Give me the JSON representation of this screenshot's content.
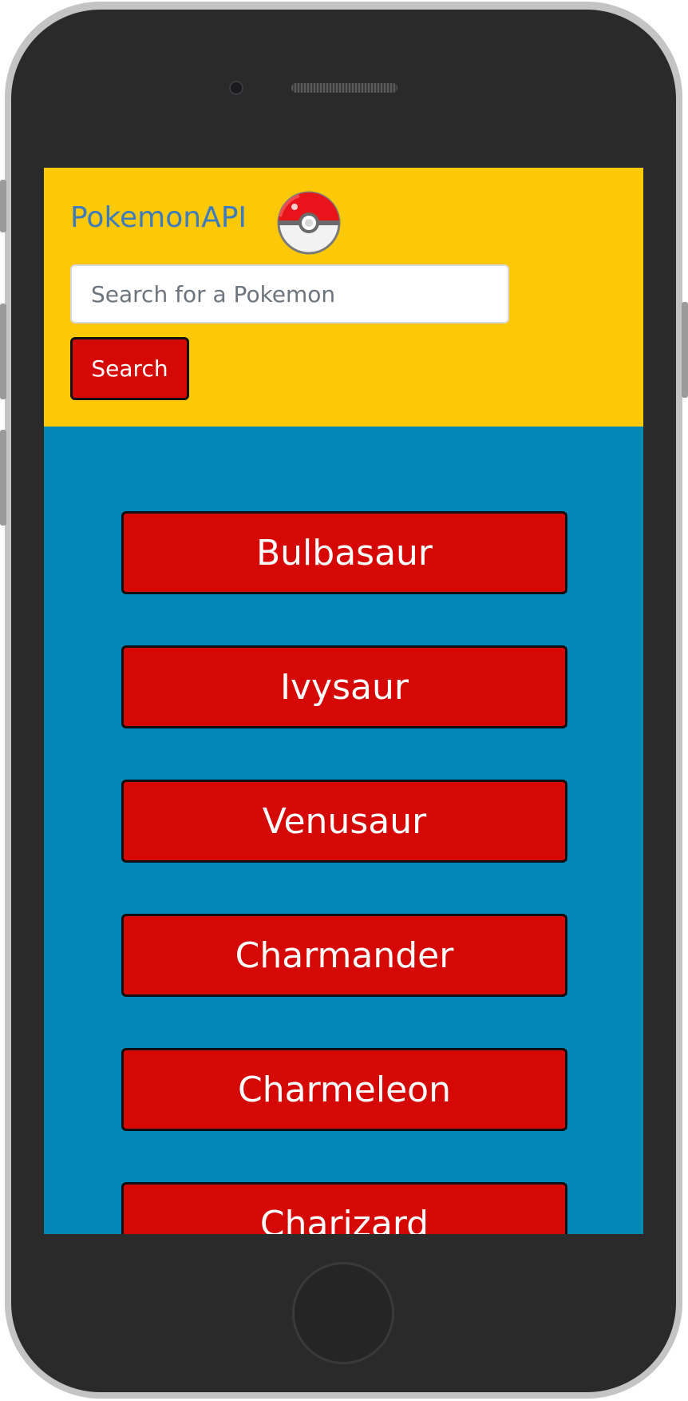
{
  "header": {
    "brand": "PokemonAPI",
    "search_placeholder": "Search for a Pokemon",
    "search_value": "",
    "search_button_label": "Search"
  },
  "pokemon_list": [
    {
      "name": "Bulbasaur"
    },
    {
      "name": "Ivysaur"
    },
    {
      "name": "Venusaur"
    },
    {
      "name": "Charmander"
    },
    {
      "name": "Charmeleon"
    },
    {
      "name": "Charizard"
    }
  ],
  "colors": {
    "header_bg": "#fdc906",
    "page_bg": "#0288b4",
    "button_red": "#d60806",
    "brand_blue": "#3d7bbd"
  },
  "icons": {
    "logo": "pokeball-icon"
  }
}
